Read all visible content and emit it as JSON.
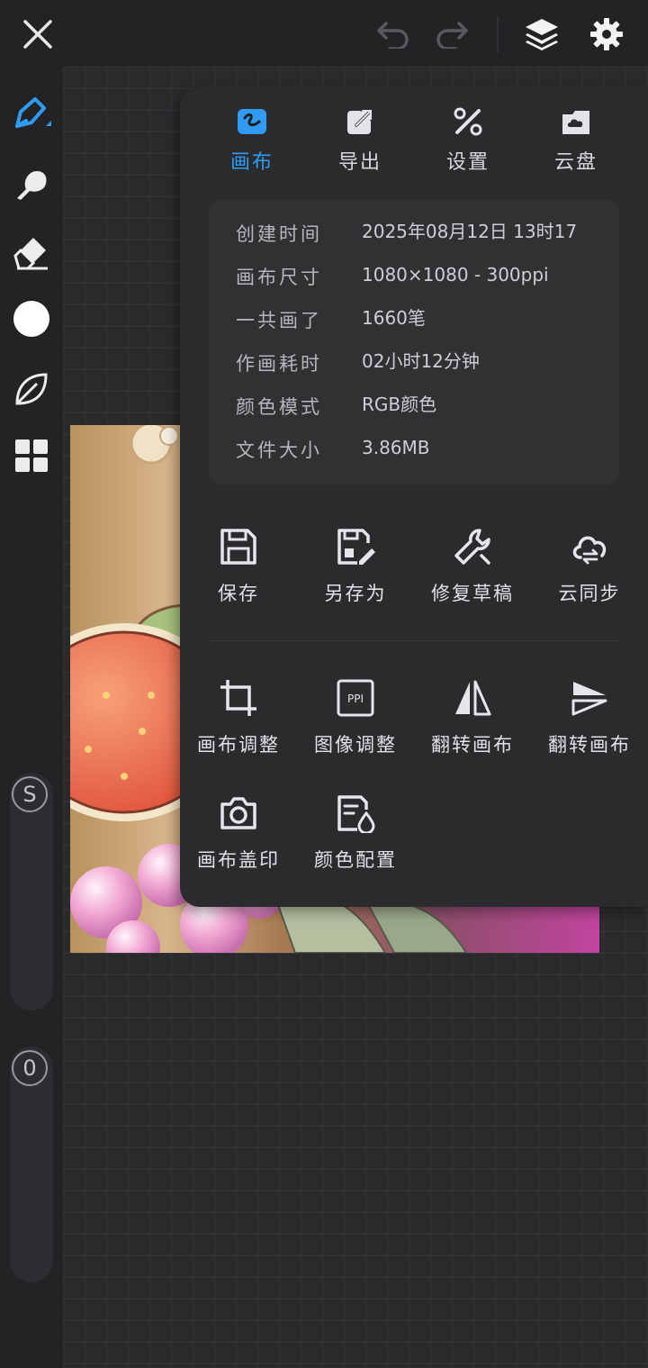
{
  "colors": {
    "accent": "#2f9bf4",
    "panel_bg": "#2b2b2e"
  },
  "topbar": {
    "close_icon": "close-icon",
    "undo_icon": "undo-icon",
    "redo_icon": "redo-icon",
    "layers_icon": "layers-icon",
    "settings_icon": "gear-icon"
  },
  "left_toolbar": {
    "tools": [
      "brush-icon",
      "smudge-icon",
      "eraser-icon",
      "color-swatch",
      "leaf-icon",
      "grid-icon"
    ],
    "size_slider_label": "S",
    "opacity_slider_label": "0"
  },
  "panel": {
    "tabs": [
      {
        "label": "画布",
        "icon": "canvas-icon",
        "active": true
      },
      {
        "label": "导出",
        "icon": "export-icon",
        "active": false
      },
      {
        "label": "设置",
        "icon": "settings-tools-icon",
        "active": false
      },
      {
        "label": "云盘",
        "icon": "cloud-drive-icon",
        "active": false
      }
    ],
    "info": [
      {
        "key": "创建时间",
        "value": "2025年08月12日 13时17分"
      },
      {
        "key": "画布尺寸",
        "value": "1080×1080 - 300ppi"
      },
      {
        "key": "一共画了",
        "value": "1660笔"
      },
      {
        "key": "作画耗时",
        "value": "02小时12分钟"
      },
      {
        "key": "颜色模式",
        "value": "RGB颜色"
      },
      {
        "key": "文件大小",
        "value": "3.86MB"
      }
    ],
    "actions_row1": [
      {
        "label": "保存",
        "icon": "save-icon"
      },
      {
        "label": "另存为",
        "icon": "save-as-icon"
      },
      {
        "label": "修复草稿",
        "icon": "repair-icon"
      },
      {
        "label": "云同步",
        "icon": "cloud-sync-icon"
      }
    ],
    "actions_row2": [
      {
        "label": "画布调整",
        "icon": "crop-icon"
      },
      {
        "label": "图像调整",
        "icon": "ppi-icon",
        "icon_text": "PPI"
      },
      {
        "label": "翻转画布",
        "icon": "flip-horizontal-icon"
      },
      {
        "label": "翻转画布",
        "icon": "flip-vertical-icon"
      }
    ],
    "actions_row3": [
      {
        "label": "画布盖印",
        "icon": "camera-icon"
      },
      {
        "label": "颜色配置",
        "icon": "color-profile-icon"
      }
    ]
  }
}
